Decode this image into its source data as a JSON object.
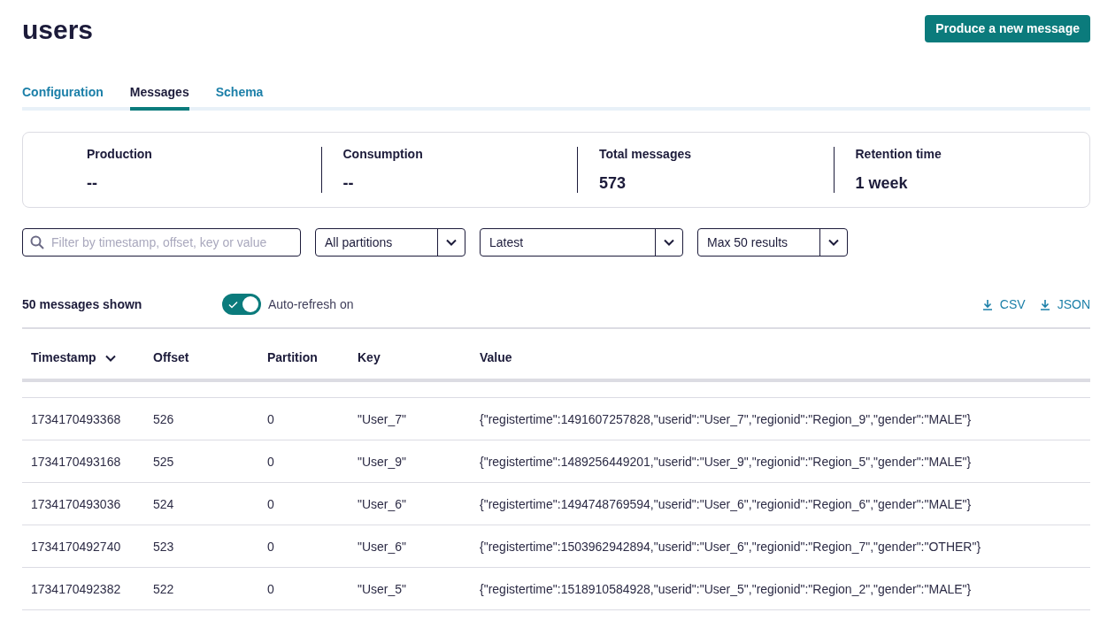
{
  "title": "users",
  "produce_button": "Produce a new message",
  "tabs": [
    {
      "label": "Configuration",
      "selected": false
    },
    {
      "label": "Messages",
      "selected": true
    },
    {
      "label": "Schema",
      "selected": false
    }
  ],
  "stats": [
    {
      "label": "Production",
      "value": "--"
    },
    {
      "label": "Consumption",
      "value": "--"
    },
    {
      "label": "Total messages",
      "value": "573"
    },
    {
      "label": "Retention time",
      "value": "1 week"
    }
  ],
  "search": {
    "placeholder": "Filter by timestamp, offset, key or value"
  },
  "selects": [
    {
      "value": "All partitions"
    },
    {
      "value": "Latest"
    },
    {
      "value": "Max 50 results"
    }
  ],
  "messages_shown": "50 messages shown",
  "auto_refresh": {
    "label": "Auto-refresh on",
    "on": true
  },
  "downloads": [
    "CSV",
    "JSON"
  ],
  "table": {
    "columns": [
      {
        "label": "Timestamp",
        "sorted": true
      },
      {
        "label": "Offset",
        "sorted": false
      },
      {
        "label": "Partition",
        "sorted": false
      },
      {
        "label": "Key",
        "sorted": false
      },
      {
        "label": "Value",
        "sorted": false
      }
    ],
    "rows": [
      [
        "1734170493368",
        "526",
        "0",
        "\"User_7\"",
        "{\"registertime\":1491607257828,\"userid\":\"User_7\",\"regionid\":\"Region_9\",\"gender\":\"MALE\"}"
      ],
      [
        "1734170493168",
        "525",
        "0",
        "\"User_9\"",
        "{\"registertime\":1489256449201,\"userid\":\"User_9\",\"regionid\":\"Region_5\",\"gender\":\"MALE\"}"
      ],
      [
        "1734170493036",
        "524",
        "0",
        "\"User_6\"",
        "{\"registertime\":1494748769594,\"userid\":\"User_6\",\"regionid\":\"Region_6\",\"gender\":\"MALE\"}"
      ],
      [
        "1734170492740",
        "523",
        "0",
        "\"User_6\"",
        "{\"registertime\":1503962942894,\"userid\":\"User_6\",\"regionid\":\"Region_7\",\"gender\":\"OTHER\"}"
      ],
      [
        "1734170492382",
        "522",
        "0",
        "\"User_5\"",
        "{\"registertime\":1518910584928,\"userid\":\"User_5\",\"regionid\":\"Region_2\",\"gender\":\"MALE\"}"
      ]
    ]
  }
}
